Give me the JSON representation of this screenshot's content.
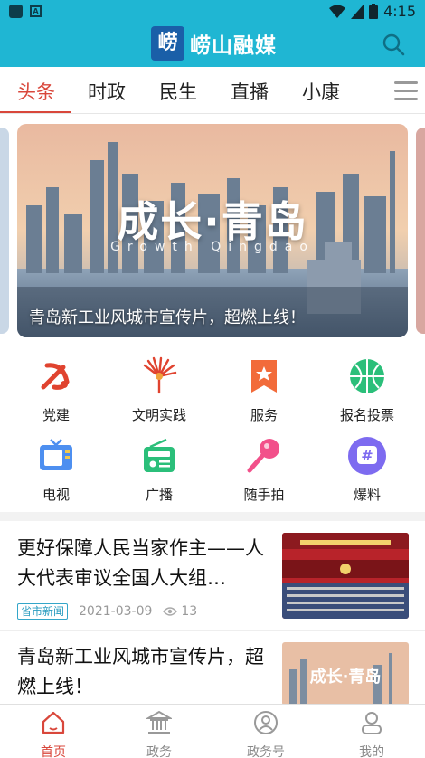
{
  "status_bar": {
    "time": "4:15"
  },
  "header": {
    "logo_char": "崂",
    "title": "崂山融媒"
  },
  "tabs": [
    {
      "label": "头条",
      "active": true
    },
    {
      "label": "时政",
      "active": false
    },
    {
      "label": "民生",
      "active": false
    },
    {
      "label": "直播",
      "active": false
    },
    {
      "label": "小康",
      "active": false
    }
  ],
  "banner": {
    "big_text": "成长·青岛",
    "sub_text": "Growth Qingdao",
    "caption": "青岛新工业风城市宣传片，超燃上线！"
  },
  "grid": [
    {
      "label": "党建",
      "icon": "party-icon",
      "color": "#e0432f"
    },
    {
      "label": "文明实践",
      "icon": "civilization-icon",
      "color": "#e0432f"
    },
    {
      "label": "服务",
      "icon": "service-icon",
      "color": "#f26b3a"
    },
    {
      "label": "报名投票",
      "icon": "vote-icon",
      "color": "#2bbf7a"
    },
    {
      "label": "电视",
      "icon": "tv-icon",
      "color": "#4d8ff0"
    },
    {
      "label": "广播",
      "icon": "radio-icon",
      "color": "#2bbf7a"
    },
    {
      "label": "随手拍",
      "icon": "microphone-icon",
      "color": "#f2508a"
    },
    {
      "label": "爆料",
      "icon": "hashtag-icon",
      "color": "#7d6bf0"
    }
  ],
  "news": [
    {
      "title": "更好保障人民当家作主——人大代表审议全国人大组…",
      "tag": "省市新闻",
      "date": "2021-03-09",
      "views": "13"
    },
    {
      "title": "青岛新工业风城市宣传片，超燃上线！"
    }
  ],
  "news_thumb2_text": "成长·青岛",
  "bottom_nav": [
    {
      "label": "首页",
      "active": true
    },
    {
      "label": "政务",
      "active": false
    },
    {
      "label": "政务号",
      "active": false
    },
    {
      "label": "我的",
      "active": false
    }
  ],
  "colors": {
    "brand": "#1fb6d3",
    "accent": "#d9473b"
  }
}
